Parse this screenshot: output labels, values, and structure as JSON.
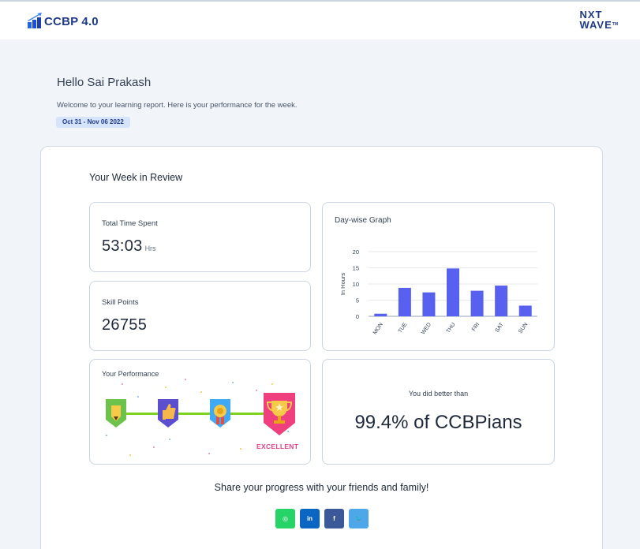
{
  "header": {
    "logo_text": "CCBP 4.0",
    "brand_line1": "NXT",
    "brand_line2": "WAVE",
    "brand_tm": "TM"
  },
  "intro": {
    "greeting": "Hello Sai Prakash",
    "welcome": "Welcome to your learning report. Here is your performance for the week.",
    "date_range": "Oct 31 - Nov 06 2022"
  },
  "review": {
    "title": "Your Week in Review",
    "time_label": "Total Time Spent",
    "time_value": "53:03",
    "time_unit": "Hrs",
    "skill_label": "Skill Points",
    "skill_value": "26755",
    "graph_title": "Day-wise Graph",
    "performance_title": "Your Performance",
    "performance_level": "EXCELLENT",
    "better_label": "You did better than",
    "better_value": "99.4% of CCBPians"
  },
  "chart_data": {
    "type": "bar",
    "ylabel": "In Hours",
    "ylim": [
      0,
      20
    ],
    "yticks": [
      0,
      5,
      10,
      15,
      20
    ],
    "categories": [
      "MON",
      "TUE",
      "WED",
      "THU",
      "FRI",
      "SAT",
      "SUN"
    ],
    "values": [
      0.8,
      8.8,
      7.4,
      14.8,
      7.9,
      9.5,
      3.3
    ],
    "bar_color": "#5861ef",
    "grid": true
  },
  "share": {
    "text": "Share your progress with your friends and family!",
    "buttons": [
      {
        "name": "whatsapp",
        "glyph": "◎",
        "color": "#25d366"
      },
      {
        "name": "linkedin",
        "glyph": "in",
        "color": "#0a66c2"
      },
      {
        "name": "facebook",
        "glyph": "f",
        "color": "#3b5998"
      },
      {
        "name": "twitter",
        "glyph": "🐦",
        "color": "#4da7e8"
      }
    ]
  }
}
